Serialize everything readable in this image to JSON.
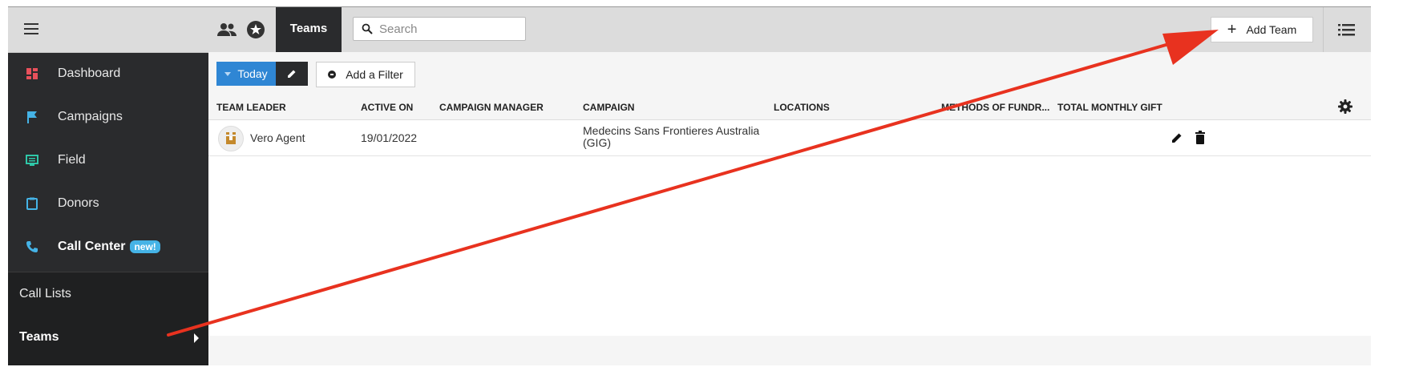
{
  "sidebar": {
    "items": [
      {
        "label": "Dashboard",
        "icon": "dashboard-icon",
        "color": "#e8505b"
      },
      {
        "label": "Campaigns",
        "icon": "flag-icon",
        "color": "#45b3e6"
      },
      {
        "label": "Field",
        "icon": "field-icon",
        "color": "#2fc7a8"
      },
      {
        "label": "Donors",
        "icon": "clipboard-icon",
        "color": "#45b3e6"
      },
      {
        "label": "Call Center",
        "icon": "phone-icon",
        "color": "#45b3e6",
        "badge": "new!"
      }
    ],
    "sub_items": [
      {
        "label": "Call Lists"
      },
      {
        "label": "Teams"
      }
    ]
  },
  "topbar": {
    "active_tab": "Teams",
    "search_placeholder": "Search",
    "add_team_label": "Add Team"
  },
  "filterbar": {
    "today_label": "Today",
    "add_filter_label": "Add a Filter"
  },
  "table": {
    "columns": [
      "TEAM LEADER",
      "ACTIVE ON",
      "CAMPAIGN MANAGER",
      "CAMPAIGN",
      "LOCATIONS",
      "METHODS OF FUNDR...",
      "TOTAL MONTHLY GIFT"
    ],
    "rows": [
      {
        "team_leader": "Vero Agent",
        "active_on": "19/01/2022",
        "campaign_manager": "",
        "campaign_line1": "Medecins Sans Frontieres Australia",
        "campaign_line2": "(GIG)",
        "locations": "",
        "methods": "",
        "total_monthly_gift": ""
      }
    ]
  },
  "colors": {
    "accent_blue": "#2f86d4",
    "annotation_red": "#e8321f",
    "sidebar_bg": "#2a2b2d"
  }
}
